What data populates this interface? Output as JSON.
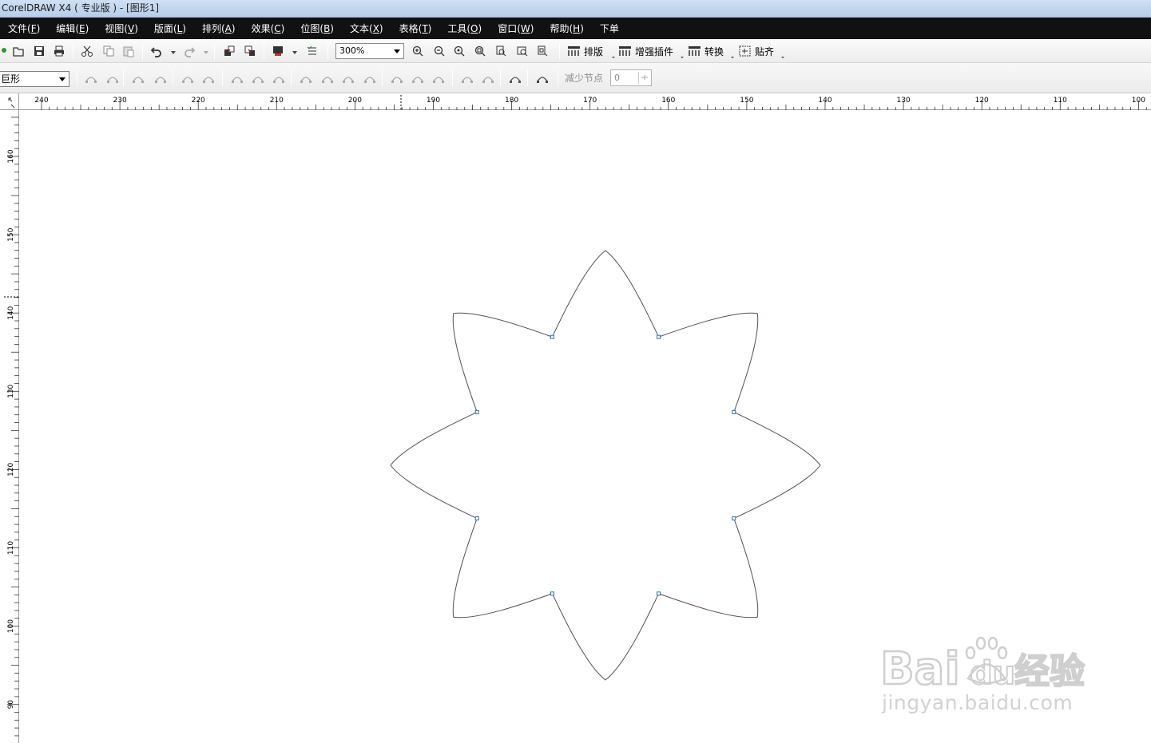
{
  "window": {
    "title": "CorelDRAW X4 ( 专业版 ) - [图形1]"
  },
  "menu": [
    {
      "label": "文件",
      "key": "F"
    },
    {
      "label": "编辑",
      "key": "E"
    },
    {
      "label": "视图",
      "key": "V"
    },
    {
      "label": "版面",
      "key": "L"
    },
    {
      "label": "排列",
      "key": "A"
    },
    {
      "label": "效果",
      "key": "C"
    },
    {
      "label": "位图",
      "key": "B"
    },
    {
      "label": "文本",
      "key": "X"
    },
    {
      "label": "表格",
      "key": "T"
    },
    {
      "label": "工具",
      "key": "O"
    },
    {
      "label": "窗口",
      "key": "W"
    },
    {
      "label": "帮助",
      "key": "H"
    },
    {
      "label": "下单",
      "key": ""
    }
  ],
  "toolbar": {
    "zoom_value": "300%",
    "layout_label": "排版",
    "plugins_label": "增强插件",
    "convert_label": "转换",
    "snap_label": "贴齐"
  },
  "property_bar": {
    "shape_type": "曲线",
    "shape_type_visible": "巨形",
    "reduce_nodes_label": "减少节点",
    "reduce_nodes_value": "0"
  },
  "ruler": {
    "h_labels": [
      "240",
      "230",
      "220",
      "210",
      "200",
      "190",
      "180",
      "170",
      "160",
      "150",
      "140",
      "130",
      "120",
      "110",
      "100"
    ],
    "v_labels": [
      "160",
      "150",
      "140",
      "130",
      "120",
      "110",
      "100",
      "90"
    ]
  },
  "watermark": {
    "brand": "Bai",
    "brand2": "du",
    "product": "经验",
    "url": "jingyan.baidu.com"
  }
}
